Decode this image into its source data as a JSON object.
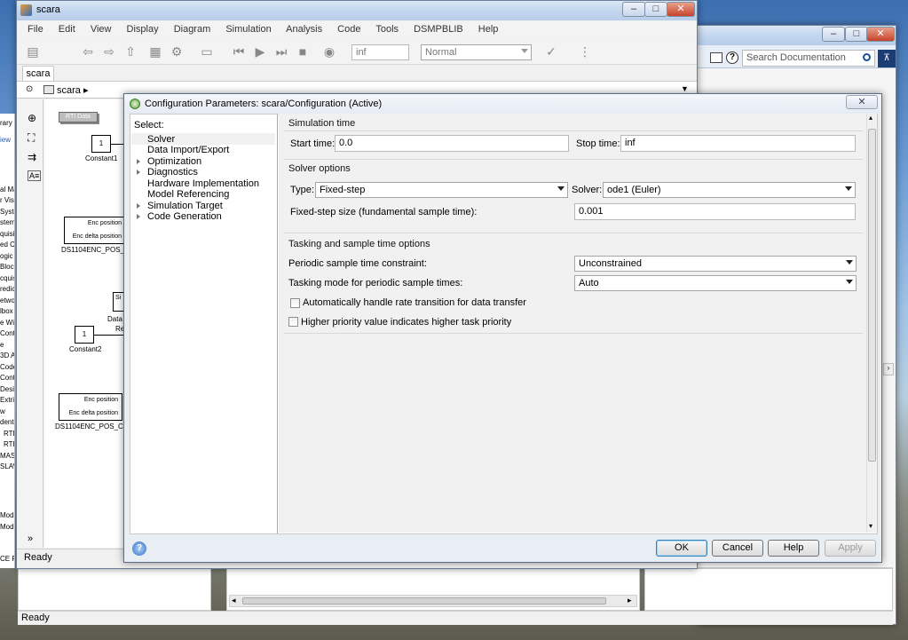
{
  "background_window": {
    "search": {
      "placeholder": "Search Documentation"
    },
    "status": "Ready"
  },
  "model_window": {
    "title": "scara",
    "menu": [
      "File",
      "Edit",
      "View",
      "Display",
      "Diagram",
      "Simulation",
      "Analysis",
      "Code",
      "Tools",
      "DSMPBLIB",
      "Help"
    ],
    "toolbar": {
      "stop_time": "inf",
      "sim_mode": "Normal"
    },
    "tab": "scara",
    "breadcrumb": "scara",
    "status": "Ready",
    "canvas": {
      "rti_data": "RTI Data",
      "constant1_value": "1",
      "constant1_label": "Constant1",
      "constant2_value": "1",
      "constant2_label": "Constant2",
      "enc1": {
        "pos": "Enc position",
        "delta": "Enc delta position",
        "label": "DS1104ENC_POS_C"
      },
      "enc2": {
        "pos": "Enc position",
        "delta": "Enc delta position",
        "label": "DS1104ENC_POS_C2"
      },
      "data_cut": "Data",
      "si_cut": "Si",
      "re_cut": "Re"
    },
    "left_library_cut": [
      "rary",
      "iew",
      "al Ma",
      "r Vis",
      "Syste",
      "stem",
      "quisit",
      "ed Co",
      "ogic",
      "Bloc",
      "cquis",
      "redic",
      "etwo",
      "lbox",
      "e Wi",
      "Contr",
      "e",
      "3D A",
      "Code",
      "Cont",
      "Desi",
      "Extri",
      "w",
      "dent",
      "RTI",
      "RTI",
      "MAS",
      "SLAV",
      "Mod",
      "Mod",
      "CE RE"
    ]
  },
  "dialog": {
    "title": "Configuration Parameters: scara/Configuration (Active)",
    "select_label": "Select:",
    "tree": [
      {
        "label": "Solver",
        "expandable": false,
        "selected": true
      },
      {
        "label": "Data Import/Export",
        "expandable": false,
        "selected": false
      },
      {
        "label": "Optimization",
        "expandable": true,
        "selected": false
      },
      {
        "label": "Diagnostics",
        "expandable": true,
        "selected": false
      },
      {
        "label": "Hardware Implementation",
        "expandable": false,
        "selected": false
      },
      {
        "label": "Model Referencing",
        "expandable": false,
        "selected": false
      },
      {
        "label": "Simulation Target",
        "expandable": true,
        "selected": false
      },
      {
        "label": "Code Generation",
        "expandable": true,
        "selected": false
      }
    ],
    "simulation_time": {
      "title": "Simulation time",
      "start_label": "Start time:",
      "start_value": "0.0",
      "stop_label": "Stop time:",
      "stop_value": "inf"
    },
    "solver_options": {
      "title": "Solver options",
      "type_label": "Type:",
      "type_value": "Fixed-step",
      "solver_label": "Solver:",
      "solver_value": "ode1 (Euler)",
      "step_label": "Fixed-step size (fundamental sample time):",
      "step_value": "0.001"
    },
    "tasking": {
      "title": "Tasking and sample time options",
      "periodic_label": "Periodic sample time constraint:",
      "periodic_value": "Unconstrained",
      "mode_label": "Tasking mode for periodic sample times:",
      "mode_value": "Auto",
      "auto_rate_label": "Automatically handle rate transition for data transfer",
      "auto_rate_checked": false,
      "priority_label": "Higher priority value indicates higher task priority",
      "priority_checked": false
    },
    "buttons": {
      "ok": "OK",
      "cancel": "Cancel",
      "help": "Help",
      "apply": "Apply"
    }
  }
}
